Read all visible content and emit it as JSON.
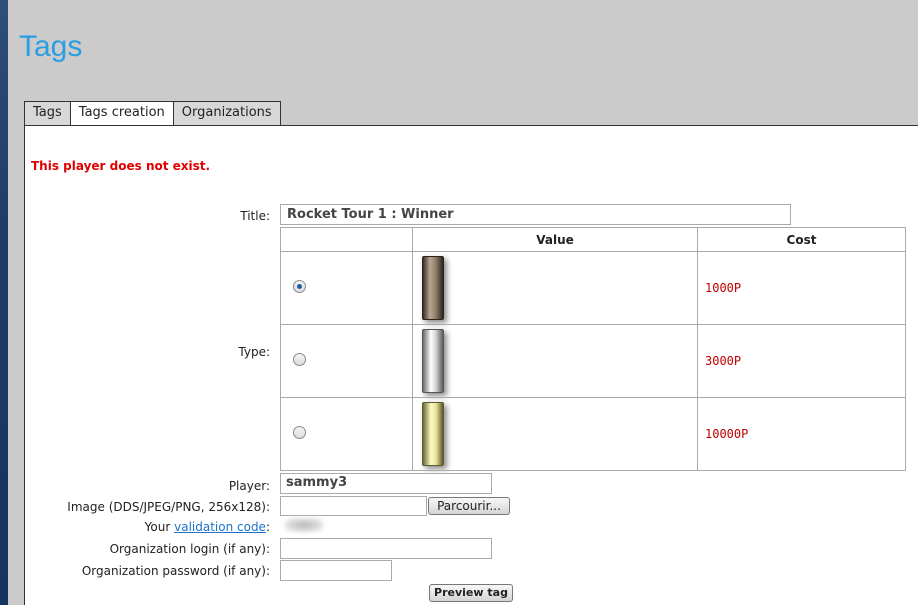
{
  "page": {
    "title": "Tags"
  },
  "tabs": [
    {
      "label": "Tags"
    },
    {
      "label": "Tags creation"
    },
    {
      "label": "Organizations"
    }
  ],
  "error_message": "This player does not exist.",
  "form": {
    "title_label": "Title:",
    "title_value": "Rocket Tour 1 : Winner",
    "type_label": "Type:",
    "table": {
      "headers": [
        "",
        "Value",
        "Cost"
      ],
      "rows": [
        {
          "selected": true,
          "tag": "bronze-tag-image",
          "cost": "1000P"
        },
        {
          "selected": false,
          "tag": "silver-tag-image",
          "cost": "3000P"
        },
        {
          "selected": false,
          "tag": "gold-tag-image",
          "cost": "10000P"
        }
      ]
    },
    "player_label": "Player:",
    "player_value": "sammy3",
    "image_label": "Image (DDS/JPEG/PNG, 256x128):",
    "browse_button": "Parcourir...",
    "validation_prefix": "Your ",
    "validation_link": "validation code",
    "validation_suffix": ":",
    "org_login_label": "Organization login (if any):",
    "org_password_label": "Organization password (if any):",
    "preview_button": "Preview tag"
  },
  "colors": {
    "title": "#2a9ee0",
    "error": "#e00000",
    "cost": "#c00000",
    "link": "#1a73c9"
  }
}
